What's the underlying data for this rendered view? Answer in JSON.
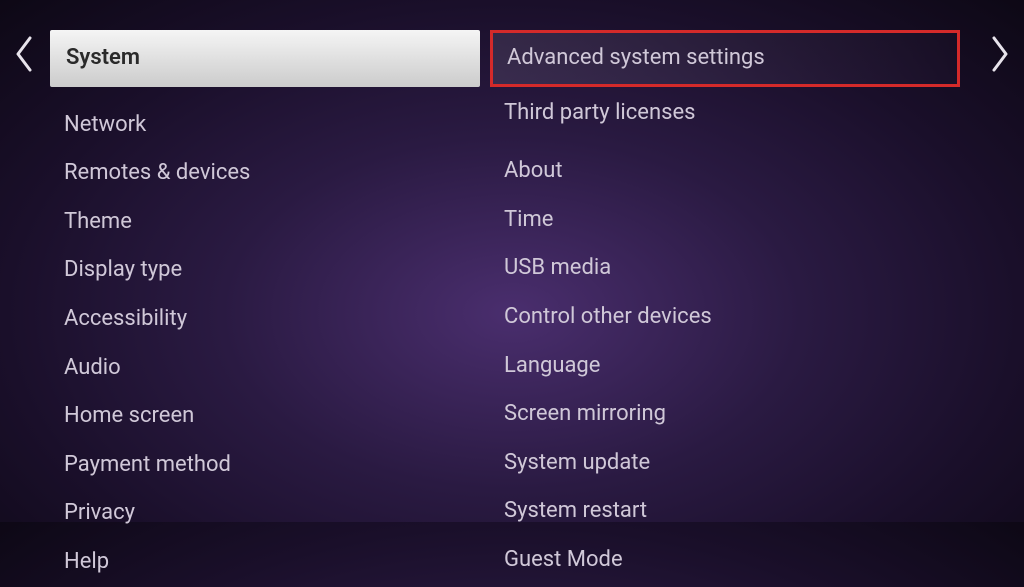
{
  "leftColumn": {
    "selected": "System",
    "items": [
      "Network",
      "Remotes & devices",
      "Theme",
      "Display type",
      "Accessibility",
      "Audio",
      "Home screen",
      "Payment method",
      "Privacy",
      "Help"
    ]
  },
  "rightColumn": {
    "highlighted": "Advanced system settings",
    "group1": [
      "Third party licenses"
    ],
    "group2": [
      "About",
      "Time",
      "USB media",
      "Control other devices",
      "Language",
      "Screen mirroring",
      "System update",
      "System restart",
      "Guest Mode"
    ]
  }
}
